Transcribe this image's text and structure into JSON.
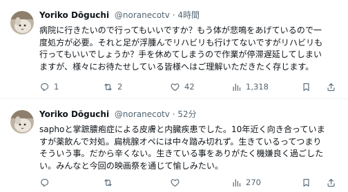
{
  "posts": [
    {
      "author_name": "Yoriko Dōguchi",
      "handle": "@noranecotv",
      "separator": "·",
      "time": "4時間",
      "lines": [
        "病院に行きたいので行ってもいいですか？もう体が悲鳴をあげているので一",
        "度処方が必要。それと足が浮腫んでリハビリも行けてないですがリハビリも",
        "行ってもいいでしょうか？手を休めてしまうので作業が停滞遅延してしまい",
        "ますが、様々にお待たせしている皆様へはご理解いただきたく存じます。"
      ],
      "replies": "1",
      "retweets": "2",
      "likes": "42",
      "views": "1,318"
    },
    {
      "author_name": "Yoriko Dōguchi",
      "handle": "@noranecotv",
      "separator": "·",
      "time": "52分",
      "lines": [
        "saphoと掌蹠膿疱症による皮膚と内臓疾患でした。10年近く向き合っていま",
        "すが薬飲んで対処。扁桃腺オペには中々踏み切れず。生きているってつまり",
        "そういう事。だから辛くない。生きている事をありがたく機嫌良く過ごした",
        "い。みんなと今回の映画祭を通じて愉しみたい。"
      ],
      "replies": "",
      "retweets": "",
      "likes": "",
      "views": "270"
    }
  ],
  "icons": {
    "reply": "reply-icon",
    "retweet": "retweet-icon",
    "like": "heart-icon",
    "views": "views-icon",
    "bookmark": "bookmark-icon",
    "share": "share-icon"
  },
  "colors": {
    "text": "#0f1419",
    "secondary": "#536471",
    "divider": "#eff3f4"
  }
}
